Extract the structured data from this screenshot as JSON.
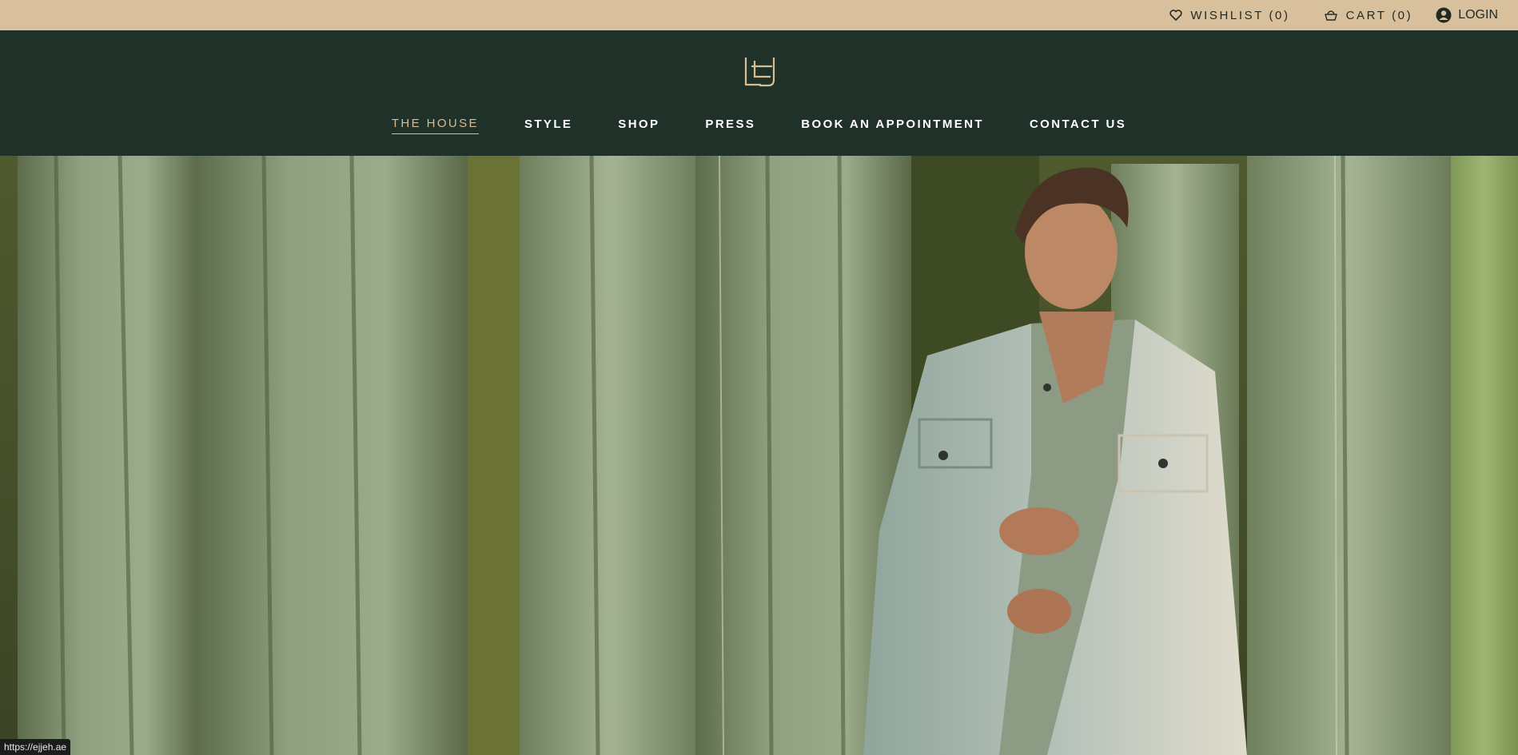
{
  "topbar": {
    "wishlist_label": "WISHLIST (0)",
    "cart_label": "CART (0)",
    "login_label": "LOGIN",
    "background": "#d9c09c"
  },
  "header": {
    "background": "#1f3129",
    "logo_icon": "ej-monogram-logo",
    "nav": [
      {
        "label": "THE HOUSE",
        "active": true
      },
      {
        "label": "STYLE",
        "active": false
      },
      {
        "label": "SHOP",
        "active": false
      },
      {
        "label": "PRESS",
        "active": false
      },
      {
        "label": "BOOK AN APPOINTMENT",
        "active": false
      },
      {
        "label": "CONTACT US",
        "active": false
      }
    ],
    "accent": "#d6bd96"
  },
  "status_bar": {
    "url": "https://ejjeh.ae"
  }
}
